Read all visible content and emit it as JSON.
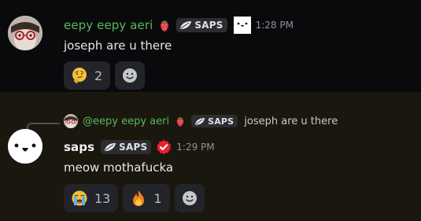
{
  "messages": [
    {
      "username": "eepy eepy aeri",
      "tag": "SAPS",
      "time": "1:28 PM",
      "text": "joseph are u there",
      "reactions": [
        {
          "emoji": "thinking-face",
          "count": "2"
        }
      ]
    },
    {
      "reply": {
        "username": "@eepy eepy aeri",
        "tag": "SAPS",
        "text": "joseph are u there"
      },
      "username": "saps",
      "tag": "SAPS",
      "time": "1:29 PM",
      "text": "meow mothafucka",
      "reactions": [
        {
          "emoji": "loudly-crying-face",
          "count": "13"
        },
        {
          "emoji": "fire",
          "count": "1"
        }
      ]
    }
  ],
  "colors": {
    "background": "#07070a",
    "highlight": "#1a170f",
    "username_green": "#58b85d",
    "verified_red": "#e8202f"
  }
}
